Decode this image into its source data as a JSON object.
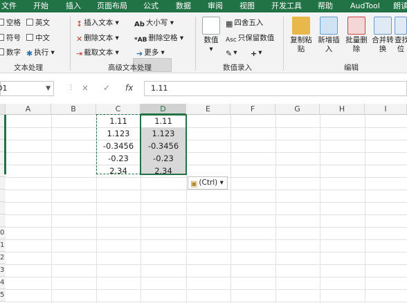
{
  "tabs": [
    "文件",
    "开始",
    "插入",
    "页面布局",
    "公式",
    "数据",
    "审阅",
    "视图",
    "开发工具",
    "帮助",
    "AudTool",
    "朗读"
  ],
  "ribbon": {
    "text_group": {
      "checks": [
        "空格",
        "英文",
        "符号",
        "中文",
        "数字"
      ],
      "exec_label": "执行",
      "label": "文本处理"
    },
    "adv_group": {
      "insert_text": "插入文本",
      "delete_text": "删除文本",
      "cut_text": "截取文本",
      "case_label": "大小写",
      "delete_space": "删除空格",
      "more_label": "更多",
      "label": "高级文本处理"
    },
    "num_group": {
      "value_label": "数值",
      "round_label": "四舍五入",
      "keep_value_label": "只保留数值",
      "label": "数值录入"
    },
    "edit_group": {
      "buttons": [
        "复制粘\n贴",
        "新增插\n入",
        "批量删\n除",
        "合并转\n换",
        "查找\n位"
      ],
      "label": "编辑"
    }
  },
  "formula_bar": {
    "name_box": "D1",
    "cancel": "×",
    "enter": "✓",
    "fx": "fx",
    "value": "1.11"
  },
  "grid": {
    "columns": [
      "A",
      "B",
      "C",
      "D",
      "E",
      "F",
      "G",
      "H",
      "I"
    ],
    "rows": [
      "",
      "",
      "",
      "",
      "",
      "",
      "",
      "",
      "",
      "0",
      "1",
      "2",
      "3",
      "4",
      "5"
    ],
    "col_c": [
      "1.11",
      "1.123",
      "-0.3456",
      "-0.23",
      "2.34"
    ],
    "col_d": [
      "1.11",
      "1.123",
      "-0.3456",
      "-0.23",
      "2.34"
    ]
  },
  "paste_options": "(Ctrl)"
}
